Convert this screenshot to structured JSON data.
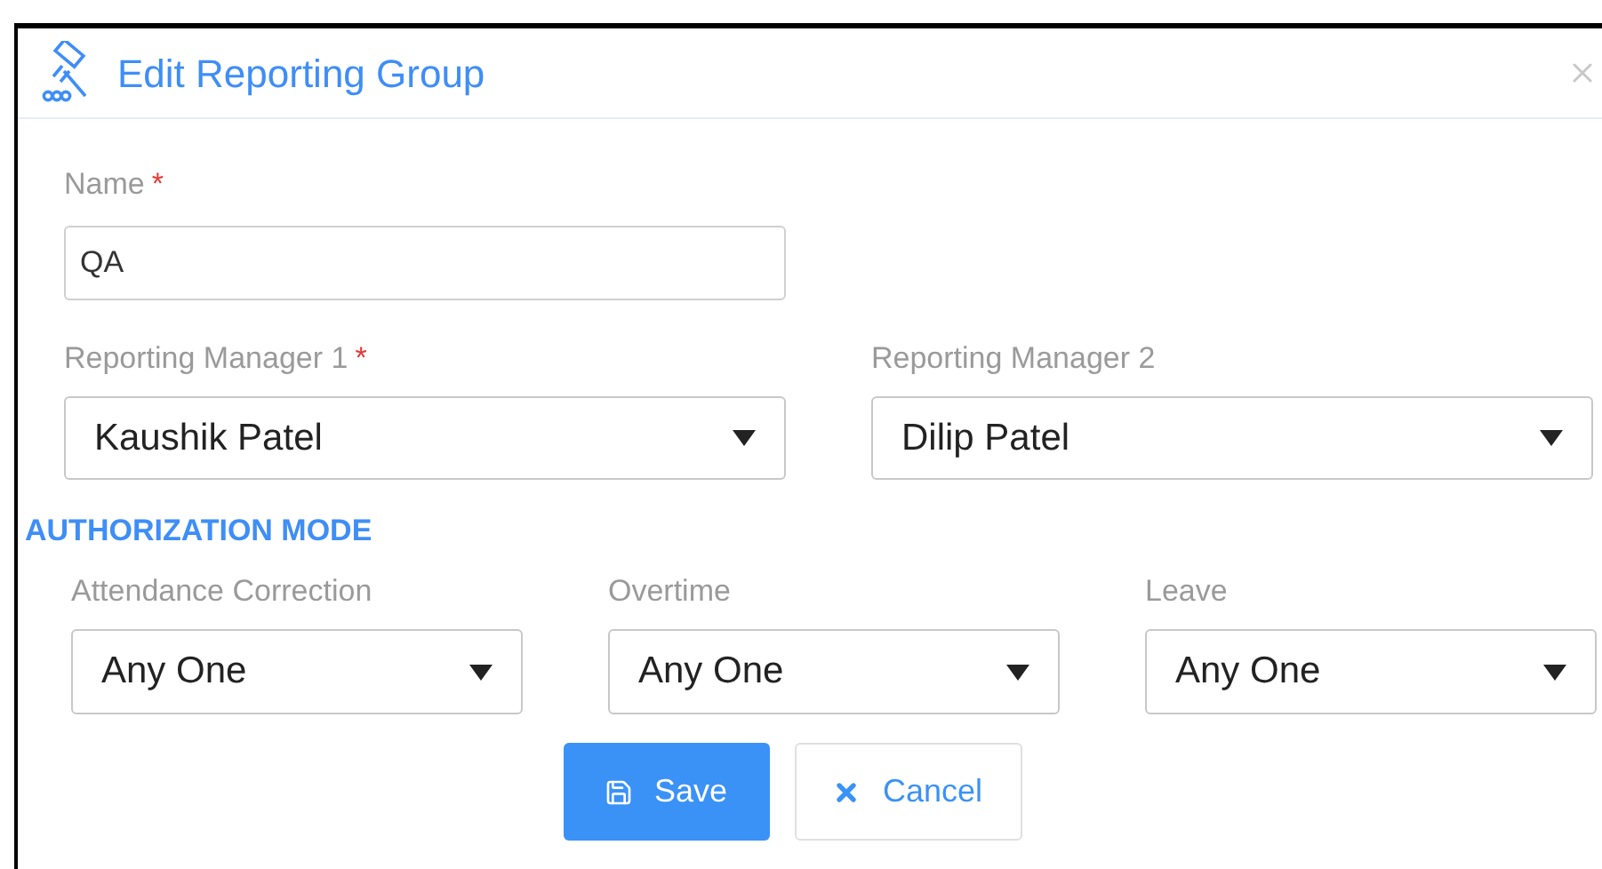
{
  "dialog": {
    "title": "Edit Reporting Group"
  },
  "name_field": {
    "label": "Name",
    "required_mark": "*",
    "value": "QA"
  },
  "managers": [
    {
      "label": "Reporting Manager 1",
      "required_mark": "*",
      "value": "Kaushik Patel"
    },
    {
      "label": "Reporting Manager 2",
      "value": "Dilip Patel"
    }
  ],
  "authorization": {
    "heading": "AUTHORIZATION MODE",
    "fields": [
      {
        "label": "Attendance Correction",
        "value": "Any One"
      },
      {
        "label": "Overtime",
        "value": "Any One"
      },
      {
        "label": "Leave",
        "value": "Any One"
      }
    ]
  },
  "buttons": [
    {
      "kind": "primary",
      "label": "Save"
    },
    {
      "kind": "secondary",
      "label": "Cancel"
    }
  ]
}
